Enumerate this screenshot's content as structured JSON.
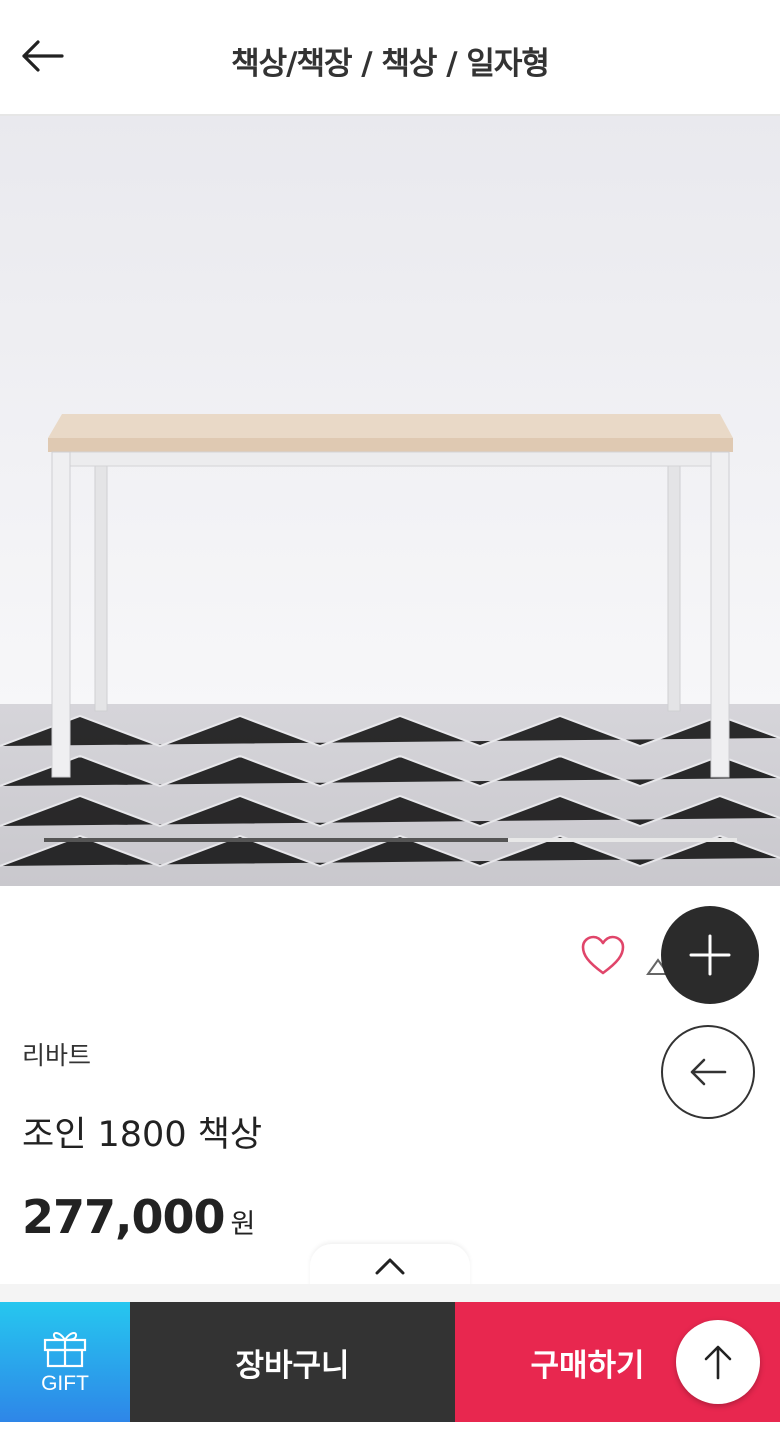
{
  "header": {
    "breadcrumb": "책상/책장 / 책상 / 일자형",
    "back_icon": "arrow-left-icon"
  },
  "gallery": {
    "image_description_icon": "product-photo",
    "progress": 0.67
  },
  "product": {
    "brand": "리바트",
    "name": "조인 1800 책상",
    "price": "277,000",
    "price_unit": "원"
  },
  "actions": {
    "like_icon": "heart-icon",
    "share_icon": "share-icon"
  },
  "fab": {
    "plus_icon": "plus-icon",
    "back_icon": "arrow-left-icon",
    "top_icon": "arrow-up-icon"
  },
  "bottom_bar": {
    "gift_label": "GIFT",
    "cart_label": "장바구니",
    "buy_label": "구매하기"
  },
  "colors": {
    "buy": "#e8274f",
    "cart": "#333333",
    "gift_top": "#26c7ef",
    "heart": "#e0456a"
  }
}
